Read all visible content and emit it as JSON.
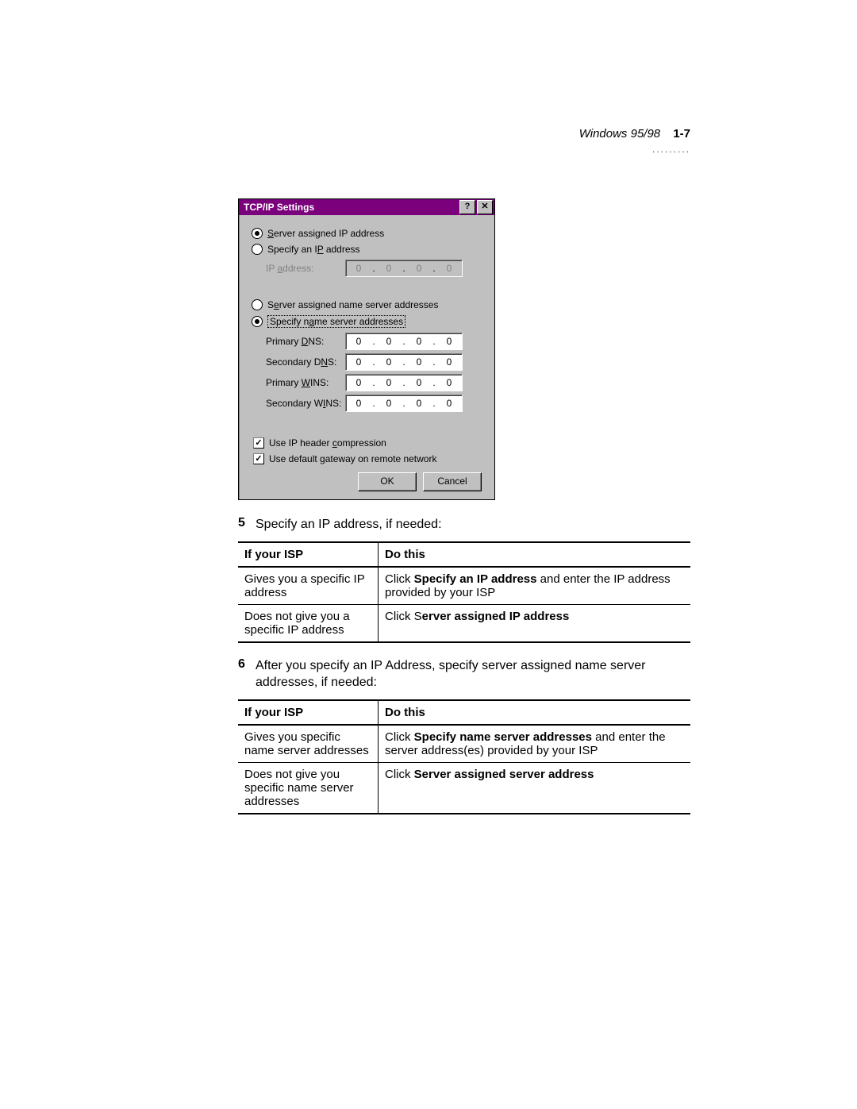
{
  "header": {
    "section": "Windows 95/98",
    "page": "1-7",
    "dots": "........."
  },
  "dialog": {
    "title": "TCP/IP Settings",
    "help_btn": "?",
    "close_btn": "✕",
    "radio_ip_server_pre": "S",
    "radio_ip_server_post": "erver assigned IP address",
    "radio_ip_specify_pre": "Specify an I",
    "radio_ip_specify_u": "P",
    "radio_ip_specify_post": " address",
    "ip_label_pre": "IP ",
    "ip_label_u": "a",
    "ip_label_post": "ddress:",
    "ip_octets": [
      "0",
      "0",
      "0",
      "0"
    ],
    "radio_ns_server_pre": "S",
    "radio_ns_server_u": "e",
    "radio_ns_server_post": "rver assigned name server addresses",
    "radio_ns_specify_pre": "Specify n",
    "radio_ns_specify_u": "a",
    "radio_ns_specify_post": "me server addresses",
    "primary_dns_pre": "Primary ",
    "primary_dns_u": "D",
    "primary_dns_post": "NS:",
    "secondary_dns_pre": "Secondary D",
    "secondary_dns_u": "N",
    "secondary_dns_post": "S:",
    "primary_wins_pre": "Primary ",
    "primary_wins_u": "W",
    "primary_wins_post": "INS:",
    "secondary_wins_pre": "Secondary W",
    "secondary_wins_u": "I",
    "secondary_wins_post": "NS:",
    "dns1": [
      "0",
      "0",
      "0",
      "0"
    ],
    "dns2": [
      "0",
      "0",
      "0",
      "0"
    ],
    "wins1": [
      "0",
      "0",
      "0",
      "0"
    ],
    "wins2": [
      "0",
      "0",
      "0",
      "0"
    ],
    "chk_compress_pre": "Use IP header ",
    "chk_compress_u": "c",
    "chk_compress_post": "ompression",
    "chk_gateway_pre": "Use default ",
    "chk_gateway_u": "g",
    "chk_gateway_post": "ateway on remote network",
    "ok": "OK",
    "cancel": "Cancel"
  },
  "steps": {
    "s5_num": "5",
    "s5_text": "Specify an IP address, if needed:",
    "s6_num": "6",
    "s6_text": "After you specify an IP Address, specify server assigned name server addresses, if needed:"
  },
  "table1": {
    "h1": "If your ISP",
    "h2": "Do this",
    "r1c1": "Gives you a specific IP address",
    "r1c2_pre": "Click ",
    "r1c2_b": "Specify an IP address",
    "r1c2_post": " and enter the IP address provided by your ISP",
    "r2c1": "Does not give you a specific IP address",
    "r2c2_pre": "Click S",
    "r2c2_b": "erver assigned IP address"
  },
  "table2": {
    "h1": "If your ISP",
    "h2": "Do this",
    "r1c1": "Gives you specific name server addresses",
    "r1c2_pre": "Click ",
    "r1c2_b": "Specify name server addresses",
    "r1c2_post": " and enter the server address(es) provided by your ISP",
    "r2c1": "Does not give you specific name server addresses",
    "r2c2_pre": "Click ",
    "r2c2_b": "Server assigned server address"
  }
}
